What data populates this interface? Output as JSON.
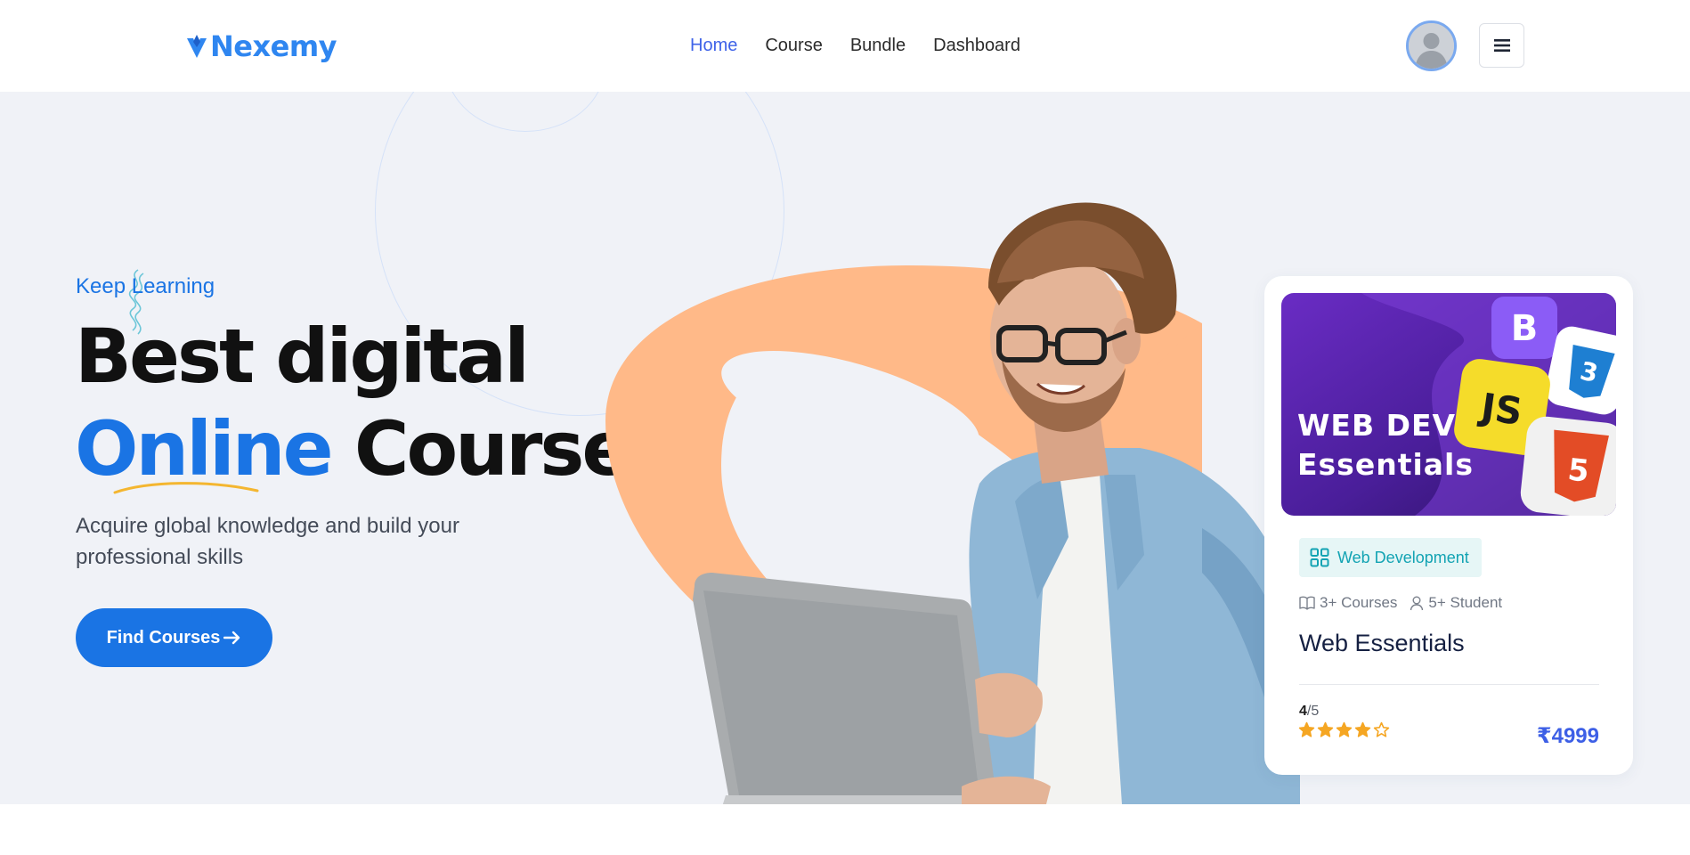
{
  "header": {
    "logo_text": "Nexemy",
    "nav": [
      {
        "label": "Home",
        "active": true
      },
      {
        "label": "Course",
        "active": false
      },
      {
        "label": "Bundle",
        "active": false
      },
      {
        "label": "Dashboard",
        "active": false
      }
    ],
    "avatar_icon": "user-avatar-icon",
    "menu_icon": "hamburger-menu-icon"
  },
  "hero": {
    "tagline": "Keep Learning",
    "headline_line1": "Best digital",
    "headline_accent": "Online",
    "headline_line2_rest": "Courses",
    "subtext": "Acquire global knowledge and build your professional skills",
    "cta_label": "Find Courses",
    "cta_icon": "arrow-right-icon"
  },
  "card": {
    "thumbnail_title_line1": "WEB DEV",
    "thumbnail_title_line2": "Essentials",
    "thumbnail_badges": [
      "B",
      "JS",
      "CSS3",
      "HTML5"
    ],
    "category": "Web Development",
    "category_icon": "grid-icon",
    "courses_count": "3+ Courses",
    "students_count": "5+ Student",
    "title": "Web Essentials",
    "rating_value": "4",
    "rating_max": "/5",
    "stars": 4,
    "price": "₹4999"
  },
  "colors": {
    "primary": "#1a74e4",
    "nav_active": "#3f63e8",
    "hero_bg": "#f0f2f7",
    "peach": "#ffb988",
    "price": "#3d5fe6",
    "star": "#f5a623",
    "teal": "#12a3b3"
  }
}
